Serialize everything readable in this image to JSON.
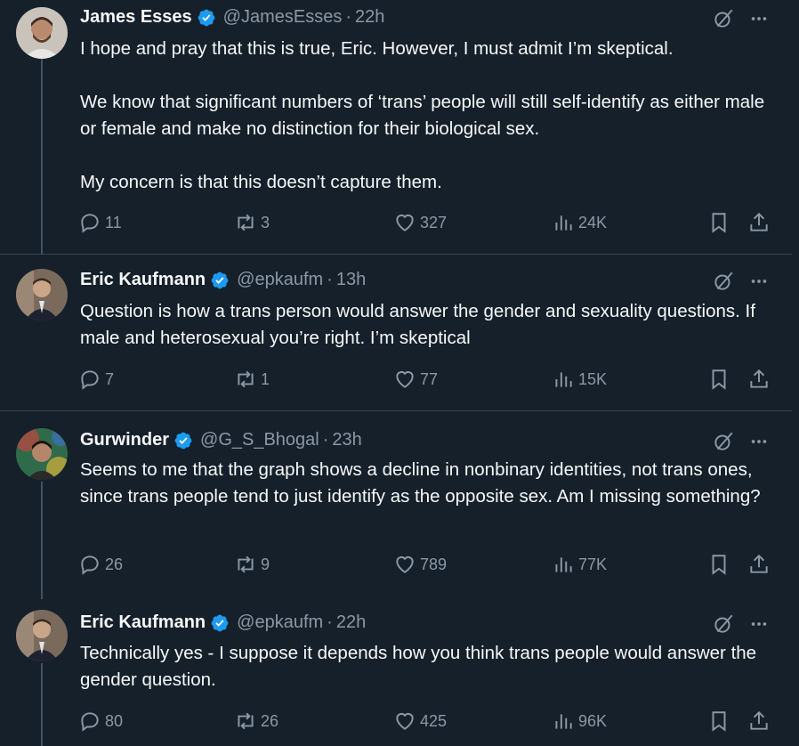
{
  "tweets": [
    {
      "name": "James Esses",
      "handle": "@JamesEsses",
      "time": "22h",
      "text": "I hope and pray that this is true, Eric. However, I must admit I’m skeptical.\n\nWe know that significant numbers of ‘trans’ people will still self-identify as either male or female and make no distinction for their biological sex.\n\nMy concern is that this doesn’t capture them.",
      "replies": "11",
      "reposts": "3",
      "likes": "327",
      "views": "24K"
    },
    {
      "name": "Eric Kaufmann",
      "handle": "@epkaufm",
      "time": "13h",
      "text": "Question is how a trans person would answer the gender and sexuality questions. If male and heterosexual you’re right. I’m skeptical",
      "replies": "7",
      "reposts": "1",
      "likes": "77",
      "views": "15K"
    },
    {
      "name": "Gurwinder",
      "handle": "@G_S_Bhogal",
      "time": "23h",
      "text": "Seems to me that the graph shows a decline in nonbinary identities, not trans ones, since trans people tend to just identify as the opposite sex. Am I missing something?",
      "replies": "26",
      "reposts": "9",
      "likes": "789",
      "views": "77K"
    },
    {
      "name": "Eric Kaufmann",
      "handle": "@epkaufm",
      "time": "22h",
      "text": "Technically yes - I suppose it depends how you think trans people would answer the gender question.",
      "replies": "80",
      "reposts": "26",
      "likes": "425",
      "views": "96K"
    }
  ],
  "separator": "·",
  "colors": {
    "background": "#15202b",
    "text": "#f7f9f9",
    "muted": "#8b98a5",
    "verified": "#1d9bf0",
    "border": "#38444d"
  },
  "icons": [
    "verified-badge-icon",
    "grok-icon",
    "more-icon",
    "reply-icon",
    "repost-icon",
    "like-icon",
    "views-icon",
    "bookmark-icon",
    "share-icon"
  ]
}
